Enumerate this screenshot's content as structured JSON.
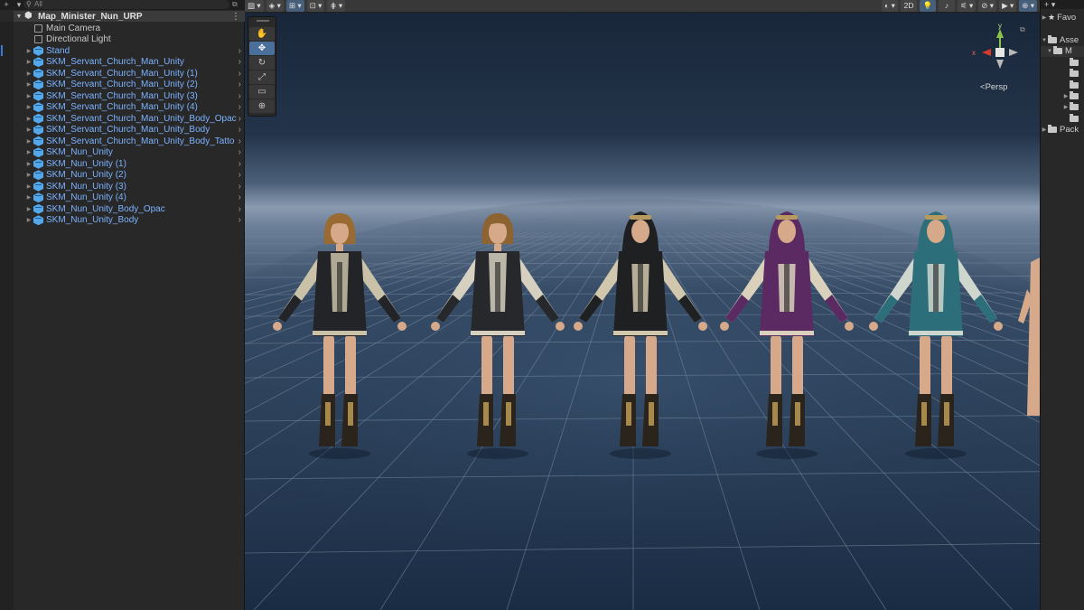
{
  "hierarchy": {
    "search_placeholder": "All",
    "add_icon": "plus-icon",
    "scene_name": "Map_Minister_Nun_URP",
    "items": [
      {
        "label": "Main Camera",
        "type": "object",
        "icon": "gameobject-icon",
        "expandable": false
      },
      {
        "label": "Directional Light",
        "type": "object",
        "icon": "gameobject-icon",
        "expandable": false
      },
      {
        "label": "Stand",
        "type": "prefab",
        "icon": "prefab-icon",
        "expandable": true
      },
      {
        "label": "SKM_Servant_Church_Man_Unity",
        "type": "prefab",
        "icon": "prefab-icon",
        "expandable": true
      },
      {
        "label": "SKM_Servant_Church_Man_Unity (1)",
        "type": "prefab",
        "icon": "prefab-icon",
        "expandable": true
      },
      {
        "label": "SKM_Servant_Church_Man_Unity (2)",
        "type": "prefab",
        "icon": "prefab-icon",
        "expandable": true
      },
      {
        "label": "SKM_Servant_Church_Man_Unity (3)",
        "type": "prefab",
        "icon": "prefab-icon",
        "expandable": true
      },
      {
        "label": "SKM_Servant_Church_Man_Unity (4)",
        "type": "prefab",
        "icon": "prefab-icon",
        "expandable": true
      },
      {
        "label": "SKM_Servant_Church_Man_Unity_Body_Opac",
        "type": "prefab",
        "icon": "prefab-icon",
        "expandable": true
      },
      {
        "label": "SKM_Servant_Church_Man_Unity_Body",
        "type": "prefab",
        "icon": "prefab-icon",
        "expandable": true
      },
      {
        "label": "SKM_Servant_Church_Man_Unity_Body_Tatto",
        "type": "prefab",
        "icon": "prefab-icon",
        "expandable": true
      },
      {
        "label": "SKM_Nun_Unity",
        "type": "prefab",
        "icon": "prefab-icon",
        "expandable": true
      },
      {
        "label": "SKM_Nun_Unity (1)",
        "type": "prefab",
        "icon": "prefab-icon",
        "expandable": true
      },
      {
        "label": "SKM_Nun_Unity (2)",
        "type": "prefab",
        "icon": "prefab-icon",
        "expandable": true
      },
      {
        "label": "SKM_Nun_Unity (3)",
        "type": "prefab",
        "icon": "prefab-icon",
        "expandable": true
      },
      {
        "label": "SKM_Nun_Unity (4)",
        "type": "prefab",
        "icon": "prefab-icon",
        "expandable": true
      },
      {
        "label": "SKM_Nun_Unity_Body_Opac",
        "type": "prefab",
        "icon": "prefab-icon",
        "expandable": true
      },
      {
        "label": "SKM_Nun_Unity_Body",
        "type": "prefab",
        "icon": "prefab-icon",
        "expandable": true
      }
    ]
  },
  "scene_view": {
    "toolbar": {
      "mode_2d_label": "2D"
    },
    "tools": [
      {
        "name": "hand-tool",
        "glyph": "✋"
      },
      {
        "name": "move-tool",
        "glyph": "✥"
      },
      {
        "name": "rotate-tool",
        "glyph": "↻"
      },
      {
        "name": "scale-tool",
        "glyph": "⤢"
      },
      {
        "name": "rect-tool",
        "glyph": "▭"
      },
      {
        "name": "transform-tool",
        "glyph": "⊕"
      }
    ],
    "gizmo": {
      "y_label": "y",
      "x_label": "x",
      "projection_label": "Persp"
    },
    "characters": [
      {
        "name": "servant-church-man-black-blonde",
        "robe": "#232427",
        "trim": "#c9c2a8",
        "hood": false,
        "hair": "#9a6a33"
      },
      {
        "name": "servant-church-man-white-sleeves",
        "robe": "#26282b",
        "trim": "#d5d0bf",
        "hood": false,
        "hair": "#8e6332"
      },
      {
        "name": "nun-black-hood",
        "robe": "#1f2022",
        "trim": "#d0c7ad",
        "hood": true,
        "hair": "#2a2722"
      },
      {
        "name": "nun-purple",
        "robe": "#5b2a63",
        "trim": "#d9d1bc",
        "hood": true,
        "hair": "#3b2348"
      },
      {
        "name": "nun-teal",
        "robe": "#2c6f7a",
        "trim": "#cfd6cd",
        "hood": true,
        "hair": "#3e8d97"
      }
    ],
    "colors": {
      "sky_top": "#1b2b40",
      "horizon": "#8ea0b5",
      "floor": "#213650",
      "grid_line": "#62748a"
    }
  },
  "project": {
    "favorites_label": "Favo",
    "assets_label": "Asse",
    "packages_label": "Pack",
    "sub_label": "M"
  }
}
